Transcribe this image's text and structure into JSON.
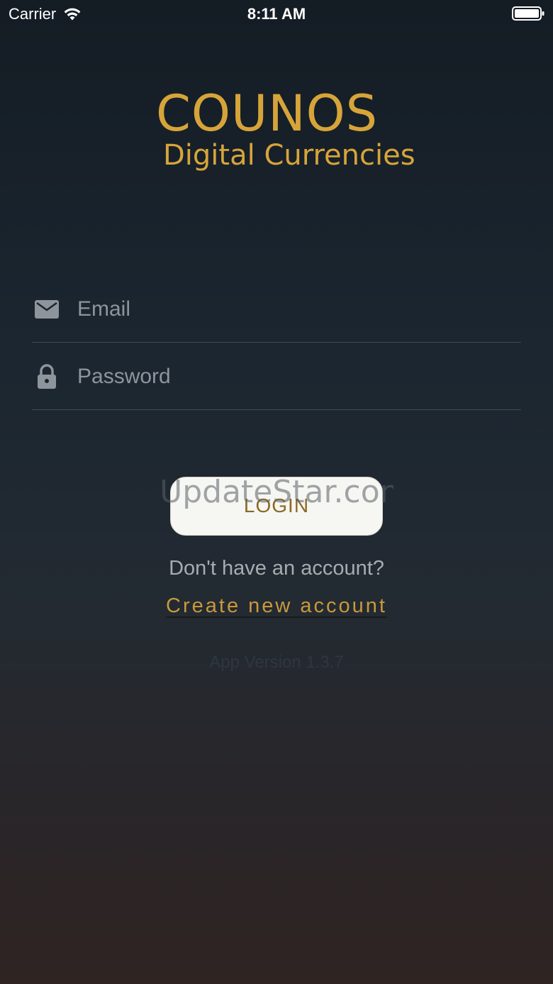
{
  "status_bar": {
    "carrier": "Carrier",
    "time": "8:11 AM",
    "icons": [
      "wifi-icon",
      "battery-icon"
    ]
  },
  "logo": {
    "title": "COUNOS",
    "subtitle": "Digital Currencies",
    "color": "#d7a43a"
  },
  "form": {
    "email": {
      "placeholder": "Email",
      "value": "",
      "icon": "envelope-icon"
    },
    "password": {
      "placeholder": "Password",
      "value": "",
      "icon": "lock-icon"
    },
    "login_label": "LOGIN"
  },
  "watermark": "UpdateStar.com",
  "signup": {
    "prompt": "Don't have an account?",
    "link_label": "Create new account"
  },
  "app_version": "App Version 1.3.7",
  "colors": {
    "accent_gold": "#c8993a",
    "button_text": "#8a6a22",
    "button_bg": "#f6f6f3"
  }
}
